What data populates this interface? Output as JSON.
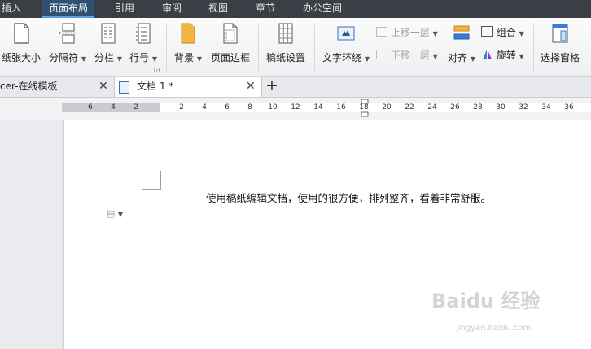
{
  "menu": {
    "items": [
      "插入",
      "页面布局",
      "引用",
      "审阅",
      "视图",
      "章节",
      "办公空间"
    ],
    "active_index": 1
  },
  "ribbon": {
    "paper_size": "纸张大小",
    "separator": "分隔符",
    "columns": "分栏",
    "line_numbers": "行号",
    "background": "背景",
    "page_border": "页面边框",
    "manuscript_settings": "稿纸设置",
    "text_wrap": "文字环绕",
    "bring_forward": "上移一层",
    "send_backward": "下移一层",
    "align": "对齐",
    "group": "组合",
    "rotate": "旋转",
    "selection_pane": "选择窗格"
  },
  "tabs": {
    "tab1": "cer-在线模板",
    "tab2": "文档 1 *",
    "close_symbol": "✕",
    "add_symbol": "+"
  },
  "ruler": {
    "ticks": [
      "6",
      "4",
      "2",
      "2",
      "4",
      "6",
      "8",
      "10",
      "12",
      "14",
      "16",
      "18",
      "20",
      "22",
      "24",
      "26",
      "28",
      "30",
      "32",
      "34",
      "36"
    ]
  },
  "document": {
    "text": "使用稿纸编辑文档，使用的很方便，排列整齐，看着非常舒服。"
  },
  "watermark": {
    "main": "Baidu 经验",
    "sub": "jingyan.baidu.com"
  },
  "colors": {
    "menubar": "#3b3f45",
    "active_tab": "#2f4f75",
    "accent": "#5aa0e8"
  }
}
